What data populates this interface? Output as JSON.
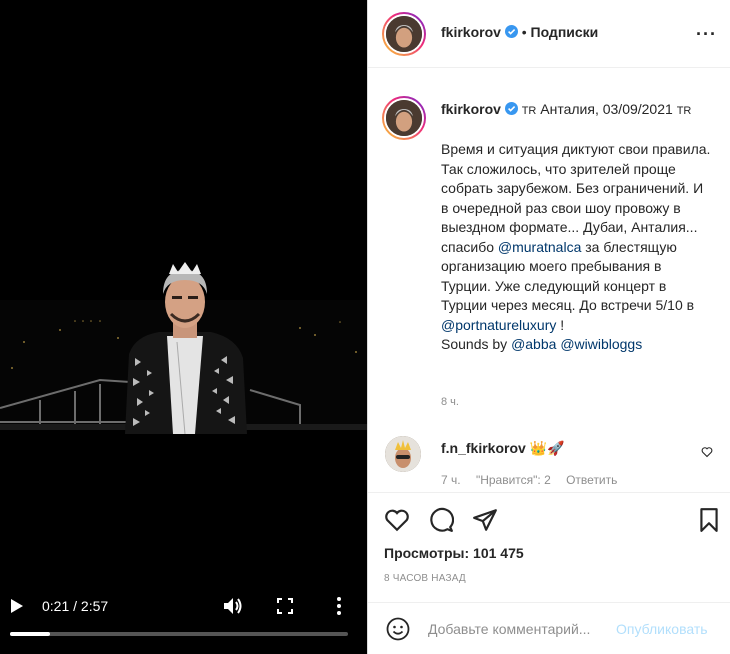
{
  "video": {
    "time_display": "0:21 / 2:57",
    "progress_fraction": 0.119,
    "play_icon": "play-icon",
    "volume_icon": "volume-icon",
    "fullscreen_icon": "fullscreen-icon",
    "more_icon": "more-vertical-icon"
  },
  "header": {
    "username": "fkirkorov",
    "separator": "•",
    "follow_status": "Подписки",
    "more_icon": "more-horizontal-icon"
  },
  "caption": {
    "username": "fkirkorov",
    "location_prefix_flag": "TR",
    "location": "Анталия, 03/09/2021",
    "location_suffix_flag": "TR",
    "text_part1": "Время и ситуация диктуют свои правила. Так сложилось, что зрителей проще собрать зарубежом. Без ограничений. И в очередной раз свои шоу провожу в выездном формате... Дубаи, Анталия... спасибо ",
    "mention1": "@muratnalca",
    "text_part2": " за блестящую организацию моего пребывания в Турции. Уже следующий концерт в Турции через месяц. До встречи 5/10 в ",
    "mention2": "@portnatureluxury",
    "text_part3": " !\nSounds by ",
    "mention3": "@abba",
    "text_part4": " ",
    "mention4": "@wiwibloggs",
    "time_ago": "8 ч."
  },
  "comment": {
    "username": "f.n_fkirkorov",
    "emojis": "👑🚀",
    "time_ago": "7 ч.",
    "likes": "\"Нравится\": 2",
    "reply": "Ответить",
    "heart_icon": "heart-outline-icon"
  },
  "actions": {
    "like_icon": "heart-icon",
    "comment_icon": "comment-icon",
    "share_icon": "send-icon",
    "save_icon": "bookmark-icon",
    "views_label": "Просмотры: 101 475",
    "date": "8 ЧАСОВ НАЗАД"
  },
  "add_comment": {
    "emoji_icon": "smiley-icon",
    "placeholder": "Добавьте комментарий...",
    "publish_label": "Опубликовать"
  },
  "colors": {
    "link": "#00376b",
    "verified": "#3897f0",
    "publish_disabled": "#b2dffc",
    "muted": "#8e8e8e"
  }
}
